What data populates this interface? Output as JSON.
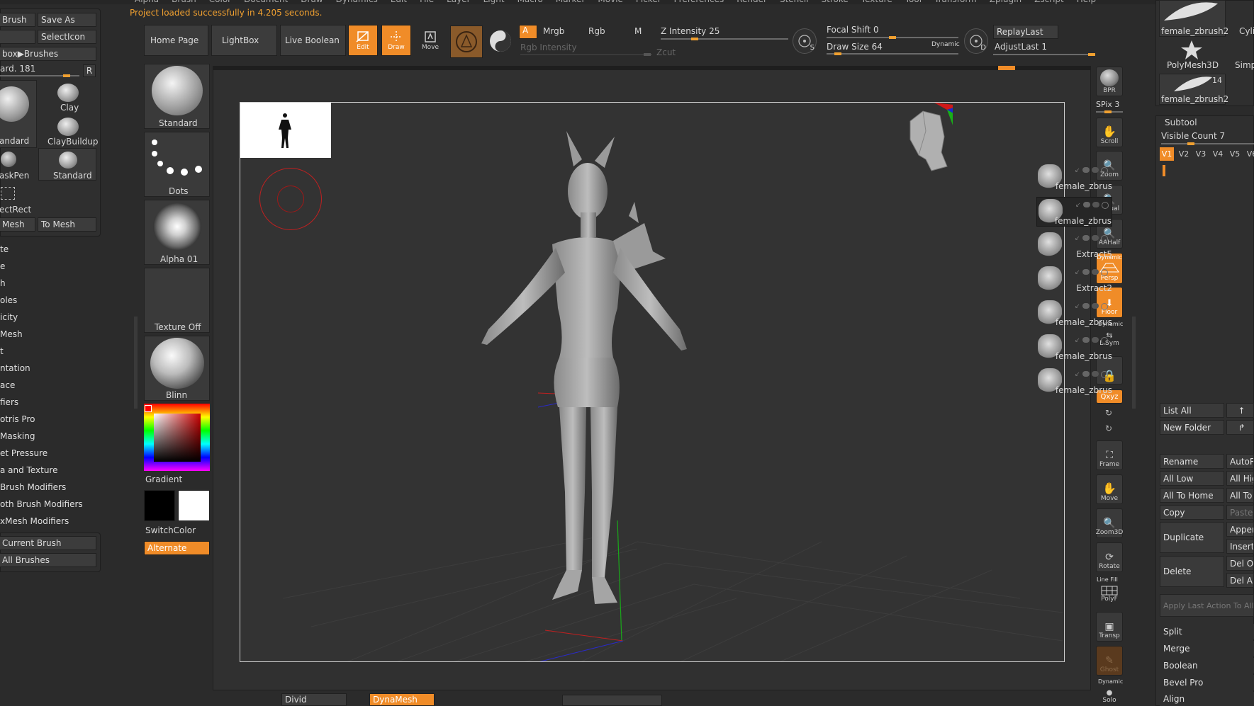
{
  "menubar": [
    "Alpha",
    "Brush",
    "Color",
    "Document",
    "Draw",
    "Dynamics",
    "Edit",
    "File",
    "Layer",
    "Light",
    "Macro",
    "Marker",
    "Movie",
    "Picker",
    "Preferences",
    "Render",
    "Stencil",
    "Stroke",
    "Texture",
    "Tool",
    "Transform",
    "Zplugin",
    "Zscript",
    "Help"
  ],
  "status_message": "Project loaded successfully in 4.205 seconds.",
  "left_panel": {
    "brush_btn": "Brush",
    "save_as": "Save As",
    "select_icon": "SelectIcon",
    "box_brushes": "box▶Brushes",
    "standard_value": "ard. 181",
    "r_btn": "R",
    "brushes": [
      "andard",
      "Clay",
      "ClayBuildup",
      "askPen",
      "Standard",
      "ectRect"
    ],
    "mesh_btn": "Mesh",
    "to_mesh": "To Mesh",
    "menu": [
      "te",
      "e",
      "h",
      "oles",
      "icity",
      "Mesh",
      "t",
      "ntation",
      "ace",
      "fiers",
      "otris Pro",
      "Masking",
      "et Pressure",
      "a and Texture",
      "Brush Modifiers",
      "oth Brush Modifiers",
      "xMesh Modifiers"
    ],
    "current_brush": "Current Brush",
    "all_brushes": "All Brushes"
  },
  "top_toolbar": {
    "home_page": "Home Page",
    "lightbox": "LightBox",
    "live_boolean": "Live Boolean",
    "edit": "Edit",
    "draw": "Draw",
    "move": "Move",
    "a_btn": "A",
    "mrgb": "Mrgb",
    "rgb": "Rgb",
    "m": "M",
    "rgb_intensity": "Rgb Intensity",
    "z_intensity": "Z Intensity 25",
    "zcut": "Zcut",
    "focal_shift": "Focal Shift 0",
    "draw_size": "Draw Size 64",
    "dynamic": "Dynamic",
    "replay_last": "ReplayLast",
    "adjust_last": "AdjustLast 1",
    "s_label": "S",
    "d_label": "D"
  },
  "sliders": {
    "z_intensity": 0.25,
    "focal_shift": 0.5,
    "draw_size": 0.06,
    "adjust_last": 1.0
  },
  "left_tray": {
    "standard": "Standard",
    "dots": "Dots",
    "alpha": "Alpha 01",
    "texture": "Texture Off",
    "material": "Blinn",
    "gradient": "Gradient",
    "switch_color": "SwitchColor",
    "alternate": "Alternate"
  },
  "right_shelf": {
    "bpr": "BPR",
    "spix": "SPix 3",
    "scroll": "Scroll",
    "zoom": "Zoom",
    "actual": "Actual",
    "aahalf": "AAHalf",
    "dynamic": "Dynamic",
    "persp": "Persp",
    "floor": "Floor",
    "dynamic2": "Dynamic",
    "lsym": "L.Sym",
    "xyz": "Qxyz",
    "frame": "Frame",
    "move": "Move",
    "zoom3d": "Zoom3D",
    "rotate": "Rotate",
    "line_fill": "Line Fill",
    "polyf": "PolyF",
    "transp": "Transp",
    "ghost": "Ghost",
    "dynamic3": "Dynamic",
    "solo": "Solo"
  },
  "right_panel": {
    "tool_thumbs": [
      "female_zbrush2",
      "Cyli",
      "PolyMesh3D",
      "Simp",
      "female_zbrush2"
    ],
    "count_badge": "14",
    "subtool_title": "Subtool",
    "visible_count": "Visible Count 7",
    "tabs": [
      "V1",
      "V2",
      "V3",
      "V4",
      "V5",
      "V6"
    ],
    "subtools": [
      "female_zbrus",
      "female_zbrus",
      "Extract5",
      "Extract2",
      "female_zbrus",
      "female_zbrus",
      "female_zbrus"
    ],
    "list_all": "List All",
    "new_folder": "New Folder",
    "rename": "Rename",
    "auto_r": "AutoR",
    "all_low": "All Low",
    "all_high": "All Hig",
    "all_to_home": "All To Home",
    "all_to": "All To",
    "copy": "Copy",
    "paste": "Paste",
    "duplicate": "Duplicate",
    "append": "Appen",
    "insert": "Insert",
    "delete": "Delete",
    "del_other": "Del Ot",
    "del_all": "Del All",
    "apply_last": "Apply Last Action To All",
    "split": "Split",
    "merge": "Merge",
    "boolean": "Boolean",
    "bevel_pro": "Bevel Pro",
    "align": "Align"
  },
  "bottom": {
    "divide": "Divid",
    "dynamesh": "DynaMesh"
  },
  "colors": {
    "accent": "#f08c28",
    "background": "#2b2b2b",
    "canvas": "#333333"
  }
}
